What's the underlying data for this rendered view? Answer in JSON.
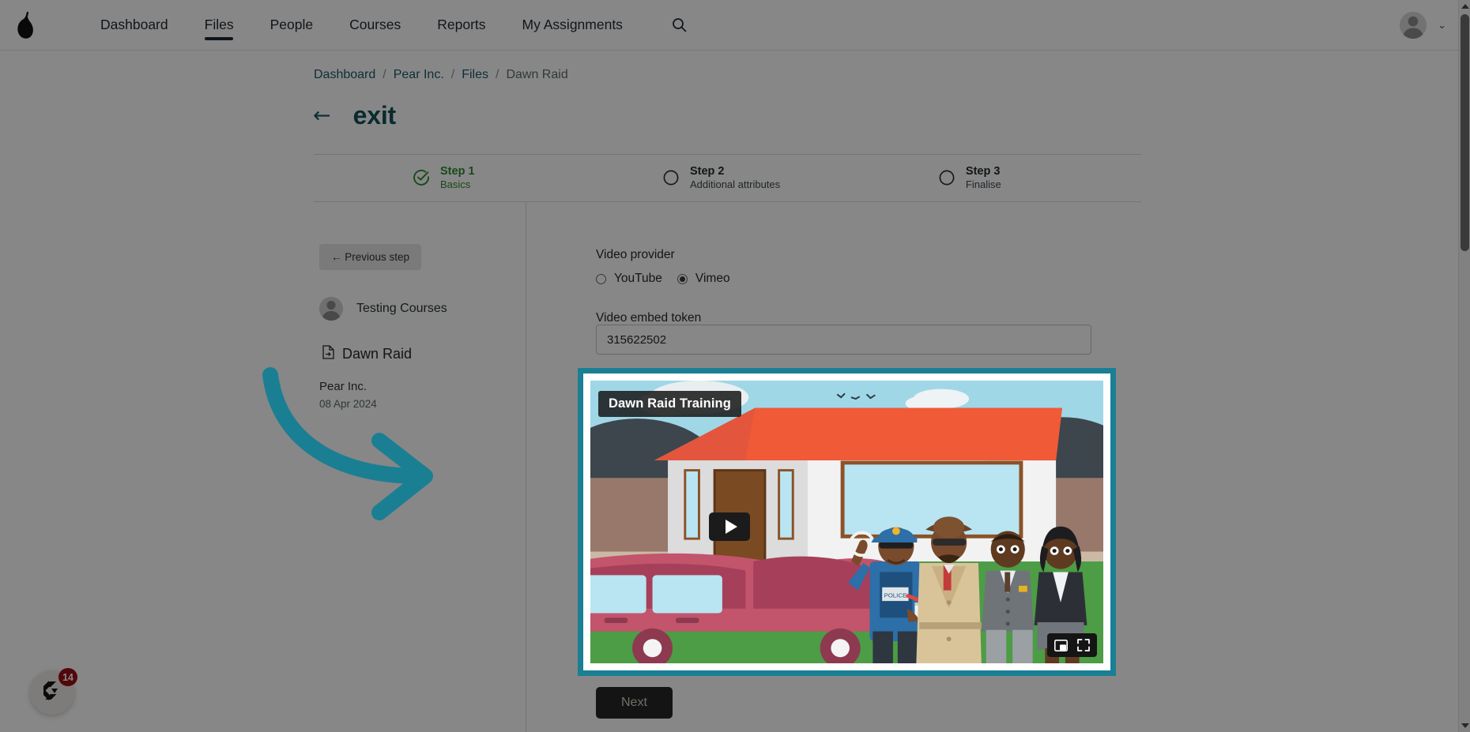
{
  "nav": {
    "brand_icon": "pear-logo-icon",
    "links": [
      {
        "label": "Dashboard",
        "active": false
      },
      {
        "label": "Files",
        "active": true
      },
      {
        "label": "People",
        "active": false
      },
      {
        "label": "Courses",
        "active": false
      },
      {
        "label": "Reports",
        "active": false
      },
      {
        "label": "My Assignments",
        "active": false
      }
    ],
    "search_icon": "search-icon",
    "avatar_icon": "user-avatar-icon",
    "chevron": "⌄"
  },
  "breadcrumb": {
    "items": [
      "Dashboard",
      "Pear Inc.",
      "Files",
      "Dawn Raid"
    ],
    "separator": "/"
  },
  "header": {
    "back_arrow": "←",
    "title": "exit"
  },
  "stepper": {
    "steps": [
      {
        "title": "Step 1",
        "sub": "Basics",
        "state": "done"
      },
      {
        "title": "Step 2",
        "sub": "Additional attributes",
        "state": "todo"
      },
      {
        "title": "Step 3",
        "sub": "Finalise",
        "state": "todo"
      }
    ]
  },
  "sidebar": {
    "previous_step_label": "← Previous step",
    "owner_name": "Testing Courses",
    "file_name": "Dawn Raid",
    "org_name": "Pear Inc.",
    "date": "08 Apr 2024"
  },
  "form": {
    "provider_label": "Video provider",
    "provider_options": [
      {
        "label": "YouTube",
        "selected": false
      },
      {
        "label": "Vimeo",
        "selected": true
      }
    ],
    "token_label": "Video embed token",
    "token_value": "315622502",
    "token_placeholder": "Video embed token",
    "next_label": "Next"
  },
  "video": {
    "title_overlay": "Dawn Raid Training",
    "play_icon": "play-icon",
    "pip_icon": "picture-in-picture-icon",
    "fullscreen_icon": "fullscreen-icon"
  },
  "chat": {
    "icon": "chat-widget-icon",
    "badge_count": "14"
  },
  "colors": {
    "accent_teal": "#1a7f93",
    "title_teal": "#14505c",
    "link_teal": "#1d5a66",
    "step_done_green": "#2f8a33",
    "badge_red": "#9b0e14"
  }
}
